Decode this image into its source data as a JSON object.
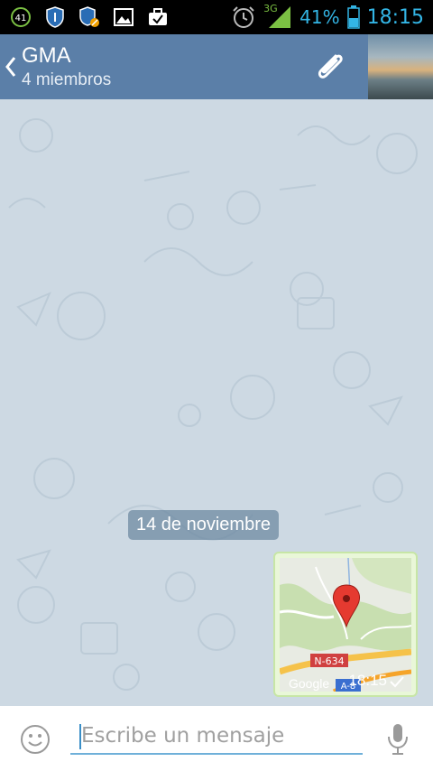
{
  "status_bar": {
    "notification_badge": "41",
    "network_type": "3G",
    "battery_percent": "41%",
    "time": "18:15",
    "accent_color": "#33b5e5"
  },
  "header": {
    "title": "GMA",
    "subtitle": "4 miembros",
    "background_color": "#5b7fa8"
  },
  "chat": {
    "date_separator": "14 de noviembre",
    "messages": [
      {
        "type": "location",
        "road_label": "N-634",
        "road_label_2": "A-8",
        "map_attribution": "Google",
        "time": "18:15",
        "status": "sent"
      }
    ]
  },
  "composer": {
    "placeholder": "Escribe un mensaje"
  }
}
